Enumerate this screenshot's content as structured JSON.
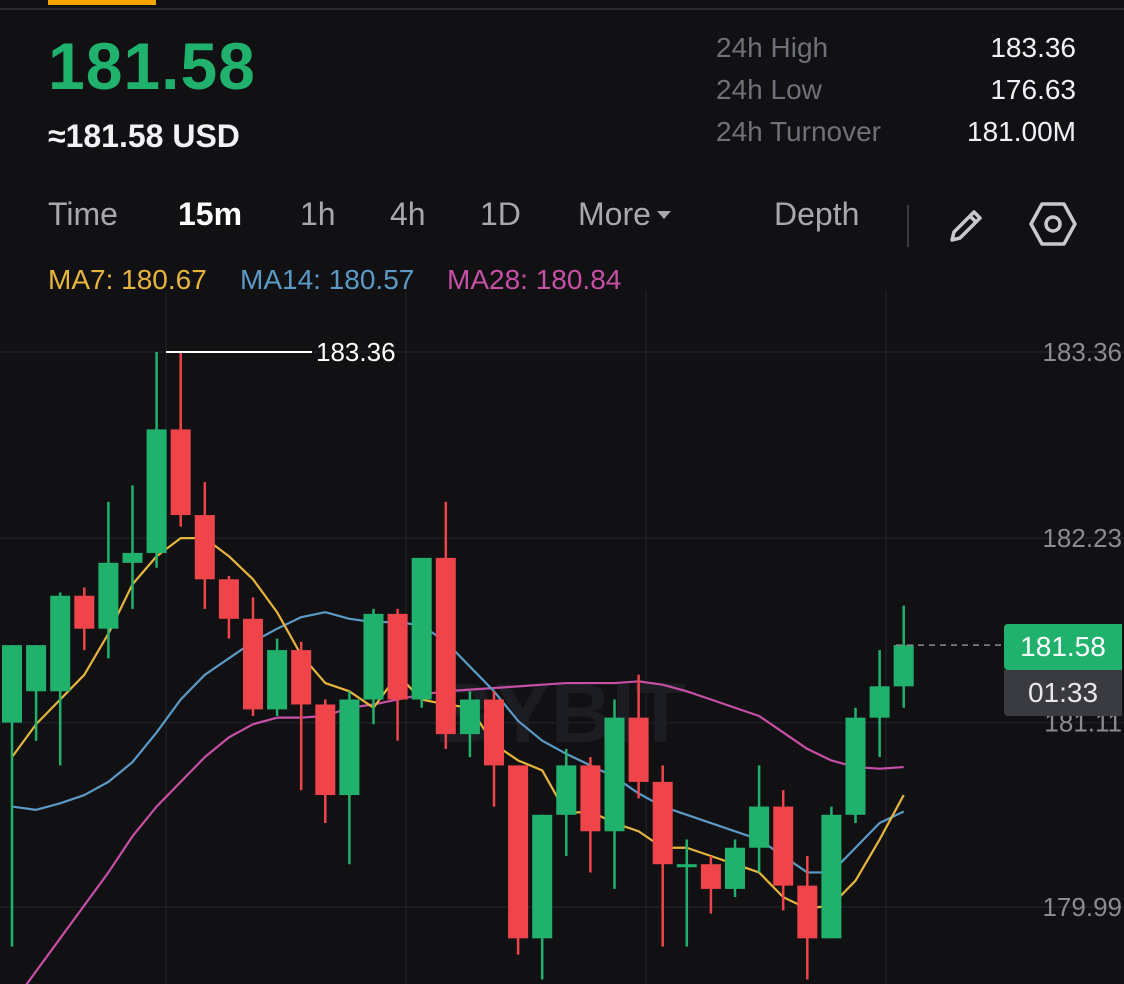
{
  "header": {
    "price": "181.58",
    "usd_equiv": "≈181.58 USD"
  },
  "stats": [
    {
      "label": "24h High",
      "value": "183.36"
    },
    {
      "label": "24h Low",
      "value": "176.63"
    },
    {
      "label": "24h Turnover",
      "value": "181.00M"
    }
  ],
  "tabs": {
    "time": "Time",
    "m15": "15m",
    "h1": "1h",
    "h4": "4h",
    "d1": "1D",
    "more": "More",
    "depth": "Depth",
    "active": "15m"
  },
  "icons": [
    "pencil-icon",
    "settings-hexagon-icon"
  ],
  "ma": {
    "ma7": "MA7: 180.67",
    "ma14": "MA14: 180.57",
    "ma28": "MA28: 180.84"
  },
  "colors": {
    "up": "#20b26c",
    "down": "#ef454a",
    "ma7": "#e7b53c",
    "ma14": "#5b9ac6",
    "ma28": "#c74fa6",
    "accent": "#f7a600"
  },
  "chart_data": {
    "type": "candlestick",
    "y_ticks": [
      "183.36",
      "182.23",
      "181.11",
      "179.99"
    ],
    "high_marker": "183.36",
    "last_price": "181.58",
    "countdown": "01:33",
    "candles": [
      {
        "o": 181.11,
        "c": 181.58,
        "h": 181.58,
        "l": 179.75
      },
      {
        "o": 181.3,
        "c": 181.58,
        "h": 181.58,
        "l": 181.0
      },
      {
        "o": 181.3,
        "c": 181.88,
        "h": 181.9,
        "l": 180.85
      },
      {
        "o": 181.88,
        "c": 181.68,
        "h": 181.93,
        "l": 181.55
      },
      {
        "o": 181.68,
        "c": 182.08,
        "h": 182.45,
        "l": 181.5
      },
      {
        "o": 182.08,
        "c": 182.14,
        "h": 182.55,
        "l": 181.8
      },
      {
        "o": 182.14,
        "c": 182.89,
        "h": 183.36,
        "l": 182.05
      },
      {
        "o": 182.89,
        "c": 182.37,
        "h": 183.36,
        "l": 182.3
      },
      {
        "o": 182.37,
        "c": 181.98,
        "h": 182.57,
        "l": 181.8
      },
      {
        "o": 181.98,
        "c": 181.74,
        "h": 182.0,
        "l": 181.62
      },
      {
        "o": 181.74,
        "c": 181.19,
        "h": 181.87,
        "l": 181.15
      },
      {
        "o": 181.19,
        "c": 181.55,
        "h": 181.62,
        "l": 181.15
      },
      {
        "o": 181.55,
        "c": 181.22,
        "h": 181.6,
        "l": 180.7
      },
      {
        "o": 181.22,
        "c": 180.67,
        "h": 181.25,
        "l": 180.5
      },
      {
        "o": 180.67,
        "c": 181.25,
        "h": 181.3,
        "l": 180.25
      },
      {
        "o": 181.25,
        "c": 181.77,
        "h": 181.8,
        "l": 181.1
      },
      {
        "o": 181.77,
        "c": 181.25,
        "h": 181.8,
        "l": 181.0
      },
      {
        "o": 181.25,
        "c": 182.11,
        "h": 182.11,
        "l": 181.2
      },
      {
        "o": 182.11,
        "c": 181.04,
        "h": 182.45,
        "l": 180.95
      },
      {
        "o": 181.04,
        "c": 181.25,
        "h": 181.3,
        "l": 180.9
      },
      {
        "o": 181.25,
        "c": 180.85,
        "h": 181.3,
        "l": 180.6
      },
      {
        "o": 180.85,
        "c": 179.8,
        "h": 180.85,
        "l": 179.7
      },
      {
        "o": 179.8,
        "c": 180.55,
        "h": 180.55,
        "l": 179.55
      },
      {
        "o": 180.55,
        "c": 180.85,
        "h": 180.95,
        "l": 180.3
      },
      {
        "o": 180.85,
        "c": 180.45,
        "h": 180.9,
        "l": 180.2
      },
      {
        "o": 180.45,
        "c": 181.14,
        "h": 181.25,
        "l": 180.1
      },
      {
        "o": 181.14,
        "c": 180.75,
        "h": 181.4,
        "l": 180.65
      },
      {
        "o": 180.75,
        "c": 180.25,
        "h": 180.85,
        "l": 179.75
      },
      {
        "o": 180.25,
        "c": 180.25,
        "h": 180.4,
        "l": 179.75
      },
      {
        "o": 180.25,
        "c": 180.1,
        "h": 180.3,
        "l": 179.95
      },
      {
        "o": 180.1,
        "c": 180.35,
        "h": 180.4,
        "l": 180.05
      },
      {
        "o": 180.35,
        "c": 180.6,
        "h": 180.85,
        "l": 180.2
      },
      {
        "o": 180.6,
        "c": 180.12,
        "h": 180.7,
        "l": 179.97
      },
      {
        "o": 180.12,
        "c": 179.8,
        "h": 180.3,
        "l": 179.55
      },
      {
        "o": 179.8,
        "c": 180.55,
        "h": 180.6,
        "l": 179.8
      },
      {
        "o": 180.55,
        "c": 181.14,
        "h": 181.2,
        "l": 180.5
      },
      {
        "o": 181.14,
        "c": 181.33,
        "h": 181.55,
        "l": 180.9
      },
      {
        "o": 181.33,
        "c": 181.58,
        "h": 181.82,
        "l": 181.2
      }
    ],
    "ma7": [
      180.9,
      181.1,
      181.25,
      181.4,
      181.65,
      181.95,
      182.12,
      182.23,
      182.23,
      182.12,
      181.98,
      181.78,
      181.52,
      181.35,
      181.3,
      181.2,
      181.4,
      181.25,
      181.22,
      181.2,
      180.98,
      180.88,
      180.82,
      180.56,
      180.57,
      180.5,
      180.45,
      180.35,
      180.35,
      180.3,
      180.25,
      180.2,
      180.05,
      179.98,
      180.0,
      180.15,
      180.4,
      180.67
    ],
    "ma14": [
      180.6,
      180.58,
      180.62,
      180.67,
      180.75,
      180.87,
      181.05,
      181.25,
      181.4,
      181.5,
      181.6,
      181.68,
      181.75,
      181.78,
      181.74,
      181.72,
      181.72,
      181.7,
      181.6,
      181.45,
      181.3,
      181.12,
      181.0,
      180.92,
      180.85,
      180.78,
      180.68,
      180.6,
      180.55,
      180.5,
      180.45,
      180.4,
      180.3,
      180.2,
      180.2,
      180.35,
      180.5,
      180.57
    ],
    "ma28": [
      179.4,
      179.6,
      179.8,
      180.0,
      180.2,
      180.42,
      180.6,
      180.75,
      180.9,
      181.02,
      181.1,
      181.14,
      181.14,
      181.15,
      181.2,
      181.22,
      181.25,
      181.28,
      181.3,
      181.31,
      181.32,
      181.33,
      181.34,
      181.35,
      181.35,
      181.35,
      181.36,
      181.34,
      181.3,
      181.25,
      181.2,
      181.15,
      181.05,
      180.95,
      180.88,
      180.84,
      180.83,
      180.84
    ]
  }
}
